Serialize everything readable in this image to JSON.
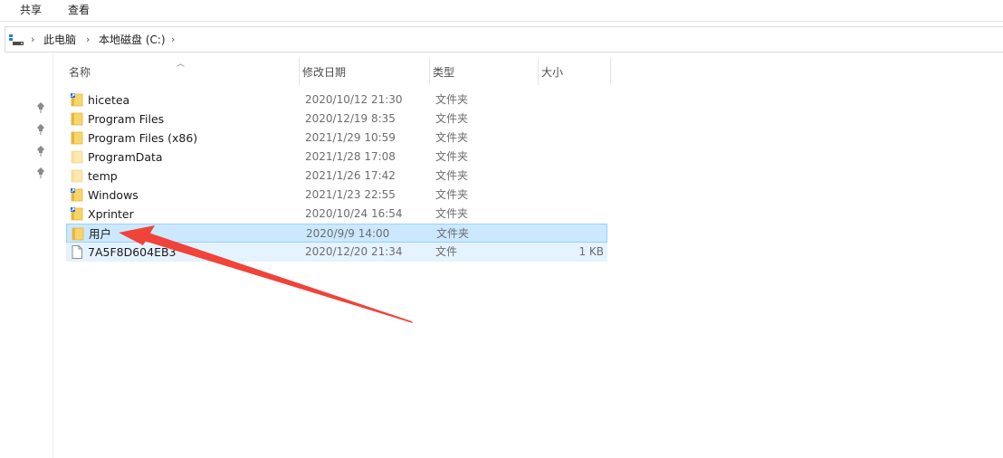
{
  "ribbon": {
    "tabs": [
      "共享",
      "查看"
    ]
  },
  "address": {
    "crumbs": [
      "此电脑",
      "本地磁盘 (C:)"
    ]
  },
  "columns": {
    "name": "名称",
    "date": "修改日期",
    "type": "类型",
    "size": "大小"
  },
  "files": [
    {
      "name": "hicetea",
      "date": "2020/10/12 21:30",
      "type": "文件夹",
      "size": "",
      "icon": "folder-shortcut-icon",
      "state": ""
    },
    {
      "name": "Program Files",
      "date": "2020/12/19 8:35",
      "type": "文件夹",
      "size": "",
      "icon": "folder-icon",
      "state": ""
    },
    {
      "name": "Program Files (x86)",
      "date": "2021/1/29 10:59",
      "type": "文件夹",
      "size": "",
      "icon": "folder-icon",
      "state": ""
    },
    {
      "name": "ProgramData",
      "date": "2021/1/28 17:08",
      "type": "文件夹",
      "size": "",
      "icon": "folder-hidden-icon",
      "state": ""
    },
    {
      "name": "temp",
      "date": "2021/1/26 17:42",
      "type": "文件夹",
      "size": "",
      "icon": "folder-hidden-icon",
      "state": ""
    },
    {
      "name": "Windows",
      "date": "2021/1/23 22:55",
      "type": "文件夹",
      "size": "",
      "icon": "folder-shortcut-icon",
      "state": ""
    },
    {
      "name": "Xprinter",
      "date": "2020/10/24 16:54",
      "type": "文件夹",
      "size": "",
      "icon": "folder-shortcut-icon",
      "state": ""
    },
    {
      "name": "用户",
      "date": "2020/9/9 14:00",
      "type": "文件夹",
      "size": "",
      "icon": "folder-icon",
      "state": "selected"
    },
    {
      "name": "7A5F8D604EB3",
      "date": "2020/12/20 21:34",
      "type": "文件",
      "size": "1 KB",
      "icon": "file-icon",
      "state": "hover"
    }
  ],
  "colors": {
    "folder": "#f7d56b",
    "folder_dark": "#e8b53c",
    "selection": "#cce8ff",
    "arrow": "#f0433a"
  }
}
